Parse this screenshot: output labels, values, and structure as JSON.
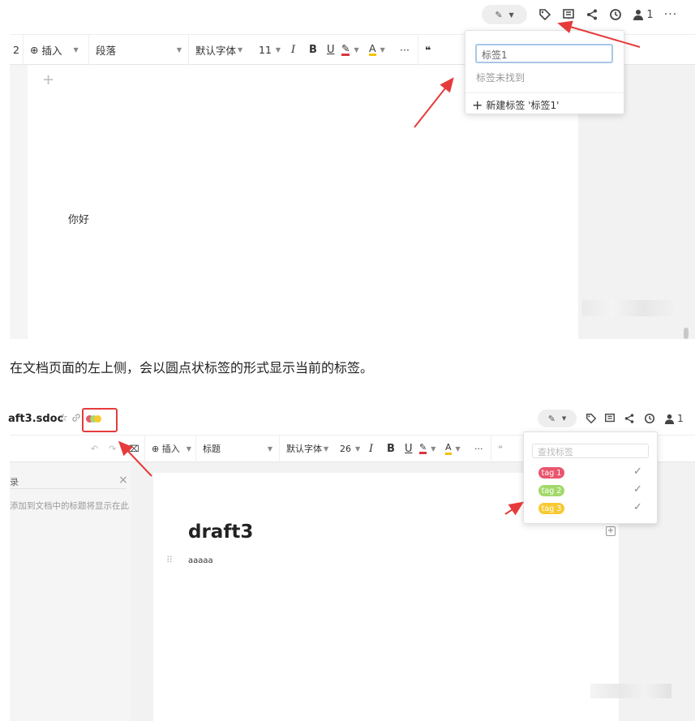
{
  "screenshot1": {
    "header": {
      "collaborators_count": "1"
    },
    "toolbar": {
      "cut_char": "2",
      "insert_label": "插入",
      "paragraph_label": "段落",
      "font_label": "默认字体",
      "font_size": "11",
      "italic": "I",
      "bold": "B",
      "underline": "U",
      "font_color": "A",
      "more": "···",
      "quote": "❝"
    },
    "editor": {
      "add_symbol": "+",
      "body_text": "你好"
    },
    "tag_dropdown": {
      "input_value": "标签1",
      "not_found_text": "标签未找到",
      "create_label": "新建标签 '标签1'"
    }
  },
  "caption": "在文档页面的左上侧，会以圆点状标签的形式显示当前的标签。",
  "screenshot2": {
    "header": {
      "doc_name": "aft3.sdoc",
      "collaborators_count": "1"
    },
    "toolbar": {
      "insert_label": "插入",
      "heading_label": "标题",
      "font_label": "默认字体",
      "font_size": "26",
      "italic": "I",
      "bold": "B",
      "underline": "U",
      "font_color": "A",
      "more": "···",
      "quote": "❝"
    },
    "outline": {
      "title_char": "录",
      "hint": "添加到文档中的标题将显示在此"
    },
    "editor": {
      "title": "draft3",
      "body_text": "aaaaa"
    },
    "tag_dropdown": {
      "search_placeholder": "查找标签",
      "tags": [
        {
          "name": "tag 1",
          "color": "#e9566d"
        },
        {
          "name": "tag 2",
          "color": "#a3d96a"
        },
        {
          "name": "tag 3",
          "color": "#f7c933"
        }
      ]
    }
  },
  "colors": {
    "annotation_red": "#e63b3b",
    "accent_red": "#d9363e",
    "accent_yellow": "#f3c300"
  }
}
